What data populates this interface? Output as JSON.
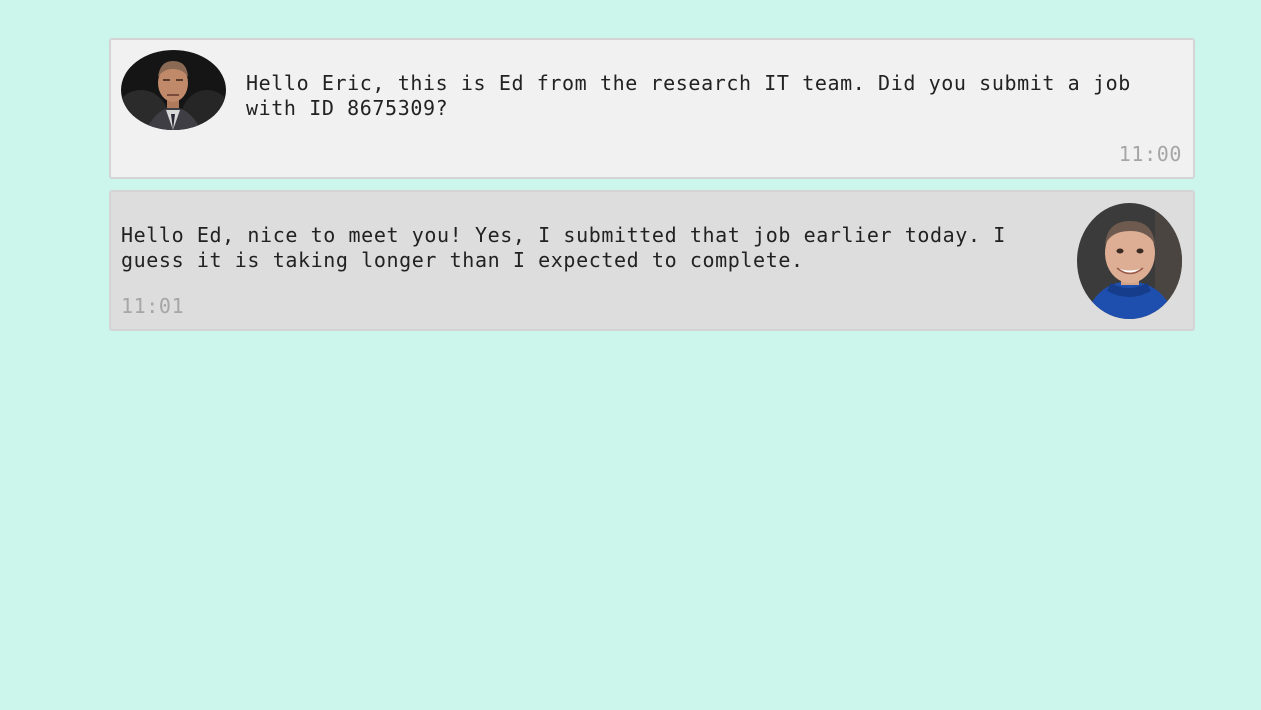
{
  "messages": [
    {
      "sender": "Ed",
      "direction": "incoming",
      "text": "Hello Eric, this is Ed from the research IT team. Did you submit a job with ID 8675309?",
      "time": "11:00"
    },
    {
      "sender": "Eric",
      "direction": "outgoing",
      "text": "Hello Ed, nice to meet you! Yes, I submitted that job earlier today. I guess it is taking longer than I expected to complete.",
      "time": "11:01"
    }
  ],
  "colors": {
    "background": "#ccf5eb",
    "incoming_bubble": "#f1f1f1",
    "outgoing_bubble": "#dddddd",
    "text": "#222222",
    "timestamp": "#a6a6a6"
  }
}
